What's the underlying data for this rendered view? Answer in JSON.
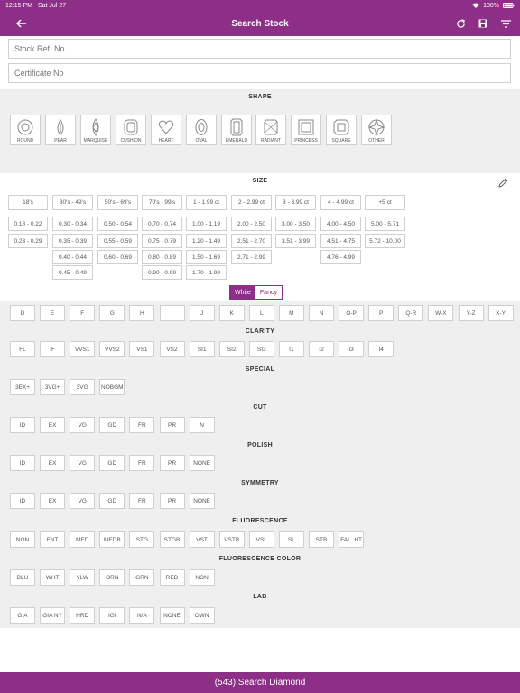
{
  "status": {
    "time": "12:15 PM",
    "date": "Sat Jul 27",
    "battery": "100%"
  },
  "header": {
    "title": "Search Stock"
  },
  "inputs": {
    "stock_ref_placeholder": "Stock Ref. No.",
    "certificate_placeholder": "Certificate No"
  },
  "sections": {
    "shape": "SHAPE",
    "size": "SIZE",
    "clarity": "CLARITY",
    "special": "SPECIAL",
    "cut": "CUT",
    "polish": "POLISH",
    "symmetry": "SYMMETRY",
    "fluorescence": "FLUORESCENCE",
    "fluorescence_color": "FLUORESCENCE COLOR",
    "lab": "LAB"
  },
  "shapes": [
    "ROUND",
    "PEAR",
    "MARQUISE",
    "CUSHION",
    "HEART",
    "OVAL",
    "EMERALD",
    "RADIANT",
    "PRINCESS",
    "SQUARE",
    "OTHER"
  ],
  "size": {
    "col1": [
      "18's",
      "0.18 - 0.22",
      "0.23 - 0.29"
    ],
    "col2": [
      "30's - 49's",
      "0.30 - 0.34",
      "0.35 - 0.39",
      "0.40 - 0.44",
      "0.45 - 0.49"
    ],
    "col3": [
      "50's - 69's",
      "0.50 - 0.54",
      "0.55 - 0.59",
      "0.60 - 0.69"
    ],
    "col4": [
      "70's - 99's",
      "0.70 - 0.74",
      "0.75 - 0.79",
      "0.80 - 0.89",
      "0.90 - 0.99"
    ],
    "col5": [
      "1 - 1.99 ct",
      "1.00 - 1.19",
      "1.20 - 1.49",
      "1.50 - 1.69",
      "1.70 - 1.99"
    ],
    "col6": [
      "2 - 2.99 ct",
      "2.00 - 2.50",
      "2.51 - 2.70",
      "2.71 - 2.99"
    ],
    "col7": [
      "3 - 3.99 ct",
      "3.00 - 3.50",
      "3.51 - 3.99"
    ],
    "col8": [
      "4 - 4.99 ct",
      "4.00 - 4.50",
      "4.51 - 4.75",
      "4.76 - 4.99"
    ],
    "col9": [
      "+5 ct",
      "5.00 - 5.71",
      "5.72 - 10.00"
    ]
  },
  "color_toggle": {
    "white": "White",
    "fancy": "Fancy",
    "selected": "White"
  },
  "colors": [
    "D",
    "E",
    "F",
    "G",
    "H",
    "I",
    "J",
    "K",
    "L",
    "M",
    "N",
    "O-P",
    "P",
    "Q-R",
    "W-X",
    "Y-Z",
    "X-Y"
  ],
  "clarity": [
    "FL",
    "IF",
    "VVS1",
    "VVS2",
    "VS1",
    "VS2",
    "SI1",
    "SI2",
    "SI3",
    "I1",
    "I2",
    "I3",
    "I4"
  ],
  "special": [
    "3EX+",
    "3VG+",
    "3VG",
    "NOBGM"
  ],
  "cut": [
    "ID",
    "EX",
    "VG",
    "GD",
    "FR",
    "PR",
    "N"
  ],
  "polish": [
    "ID",
    "EX",
    "VG",
    "GD",
    "FR",
    "PR",
    "NONE"
  ],
  "symmetry": [
    "ID",
    "EX",
    "VG",
    "GD",
    "FR",
    "PR",
    "NONE"
  ],
  "fluorescence": [
    "NON",
    "FNT",
    "MED",
    "MEDB",
    "STG",
    "STGB",
    "VST",
    "VSTB",
    "VSL",
    "SL",
    "STB",
    "FAI...HT"
  ],
  "fluorescence_color": [
    "BLU",
    "WHT",
    "YLW",
    "ORN",
    "GRN",
    "RED",
    "NON"
  ],
  "lab": [
    "GIA",
    "GIA NY",
    "HRD",
    "IGI",
    "N/A",
    "NONE",
    "OWN"
  ],
  "footer": {
    "label": "(543) Search Diamond"
  },
  "theme": {
    "primary": "#8e2f87"
  }
}
